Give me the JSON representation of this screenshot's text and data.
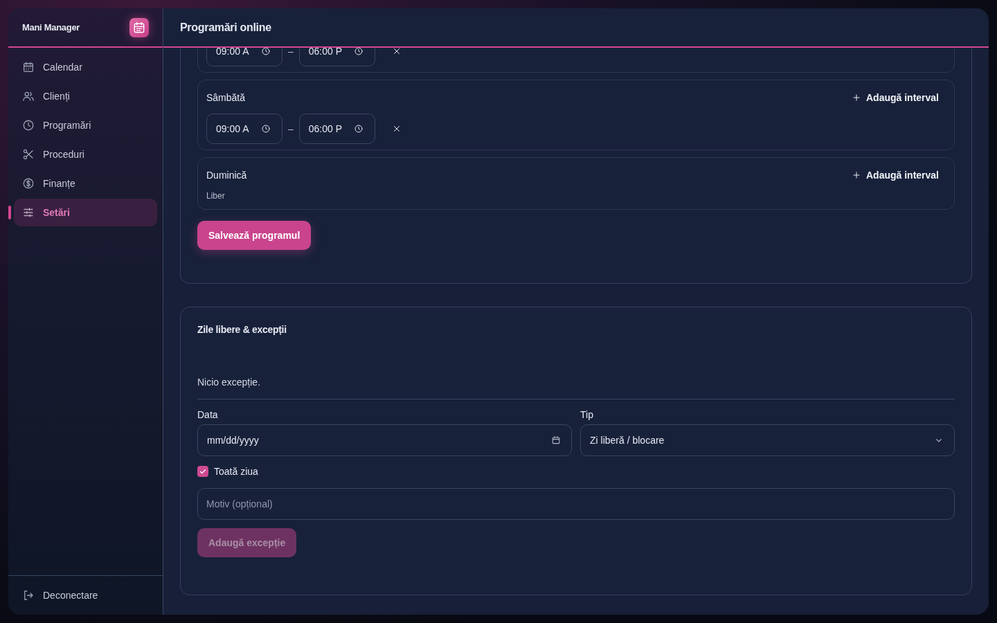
{
  "sidebar": {
    "brand": "Mani Manager",
    "items": [
      {
        "label": "Calendar",
        "selected": false
      },
      {
        "label": "Clienți",
        "selected": false
      },
      {
        "label": "Programări",
        "selected": false
      },
      {
        "label": "Proceduri",
        "selected": false
      },
      {
        "label": "Finanțe",
        "selected": false
      },
      {
        "label": "Setări",
        "selected": true
      }
    ],
    "footer": {
      "label": "Deconectare"
    }
  },
  "header": {
    "title": "Programări online"
  },
  "schedule": {
    "days": [
      {
        "intervals": [
          {
            "start": "09:00 A",
            "separator": "–",
            "end": "06:00 P"
          }
        ]
      },
      {
        "label": "Sâmbătă",
        "add_label": "Adaugă interval",
        "intervals": [
          {
            "start": "09:00 A",
            "separator": "–",
            "end": "06:00 P"
          }
        ]
      },
      {
        "label": "Duminică",
        "add_label": "Adaugă interval",
        "free_label": "Liber"
      }
    ],
    "save_button": {
      "label": "Salvează programul"
    }
  },
  "exceptions": {
    "title": "Zile libere & excepții",
    "empty": "Nicio excepție.",
    "date": {
      "label": "Data",
      "placeholder": "mm/dd/yyyy"
    },
    "type": {
      "label": "Tip",
      "value": "Zi liberă / blocare"
    },
    "all_day": {
      "label": "Toată ziua",
      "checked": true
    },
    "reason": {
      "placeholder": "Motiv (opțional)"
    },
    "add_button": {
      "label": "Adaugă excepție",
      "disabled": true
    }
  }
}
